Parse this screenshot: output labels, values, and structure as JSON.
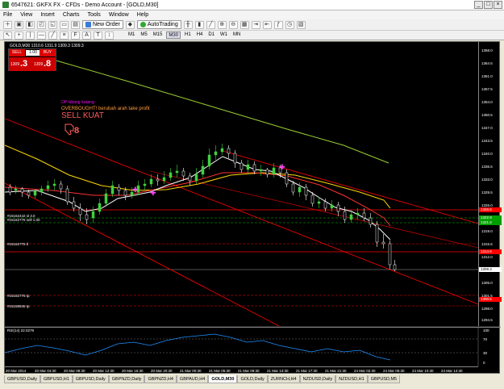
{
  "window": {
    "title": "6547621: GKFX FX - CFDs - Demo Account - [GOLD,M30]",
    "buttons": [
      "_",
      "□",
      "×"
    ]
  },
  "menu": [
    "File",
    "View",
    "Insert",
    "Charts",
    "Tools",
    "Window",
    "Help"
  ],
  "toolbar": {
    "new_order": "New Order",
    "autotrading": "AutoTrading",
    "timeframes": [
      "M1",
      "M5",
      "M15",
      "M30",
      "H1",
      "H4",
      "D1",
      "W1",
      "MN"
    ],
    "active_timeframe": "M30"
  },
  "chart": {
    "symbol_label": "GOLD,M30  1310.6 1311.9 1309.3 1309.3",
    "trade_panel": {
      "sell_label": "SELL",
      "buy_label": "BUY",
      "lot": "1.00",
      "sell_small": "1309",
      "sell_big": ".3",
      "buy_small": "1309",
      "buy_big": ".8"
    },
    "annotations": {
      "line1": "OP lubang lusiang",
      "line2": "OVERBOUGHT! berubah arah take profit",
      "line3": "SELL KUAT",
      "thumb_icon": "thumbs-down-icon"
    },
    "hline_labels": {
      "a": "#15162442 sl 3.0",
      "b": "#15162776 sell 1.00",
      "c": "#15162776 tl",
      "d": "#15162776 tp",
      "e": "#15158945 tp"
    },
    "price_ticks": [
      "1368.0",
      "1364.5",
      "1361.0",
      "1357.5",
      "1354.0",
      "1350.5",
      "1347.0",
      "1343.5",
      "1340.0",
      "1336.5",
      "1333.0",
      "1329.5",
      "1326.0",
      "1322.5",
      "1319.0",
      "1315.5",
      "1312.0",
      "1308.5",
      "1305.0",
      "1301.5",
      "1298.0",
      "1294.5"
    ],
    "price_tags": {
      "red_high": "1326.5",
      "green1": "1322.9",
      "green2": "1321.8",
      "red_mid": "1314.9",
      "current": "1309.3",
      "red_low": "1300.5"
    },
    "colors": {
      "background": "#000000",
      "candle_up": "#3fd23f",
      "candle_down": "#ffffff",
      "ma_green": "#9acd32",
      "ma_yellow": "#ffd700",
      "ma_white": "#ffffff",
      "ma_red": "#ff3030",
      "channel": "#ff0000",
      "rsi": "#1e90ff",
      "marker": "#ff44ff"
    },
    "rsi": {
      "label": "RSI(14) 22.0279",
      "ticks": [
        "100",
        "70",
        "30",
        "0"
      ]
    },
    "time_ticks": [
      "20 Mar 2014",
      "20 Mar 04:30",
      "20 Mar 08:30",
      "20 Mar 12:30",
      "20 Mar 16:30",
      "20 Mar 20:30",
      "21 Mar 00:30",
      "21 Mar 05:30",
      "21 Mar 09:30",
      "21 Mar 13:30",
      "21 Mar 17:30",
      "21 Mar 21:30",
      "24 Mar 02:30",
      "24 Mar 06:30",
      "24 Mar 10:30",
      "24 Mar 14:30"
    ]
  },
  "tabs": [
    "GBPUSD,Daily",
    "GBPUSD,H1",
    "GBPUSD,Daily",
    "GBPNZD,Daily",
    "GBPNZD,H4",
    "GBPAUD,H4",
    "GOLD,M30",
    "GOLD,Daily",
    "ZURNCH,H4",
    "NZDUSD,Daily",
    "NZDUSD,H1",
    "GBPUSD,M5"
  ],
  "active_tab": "GOLD,M30"
}
